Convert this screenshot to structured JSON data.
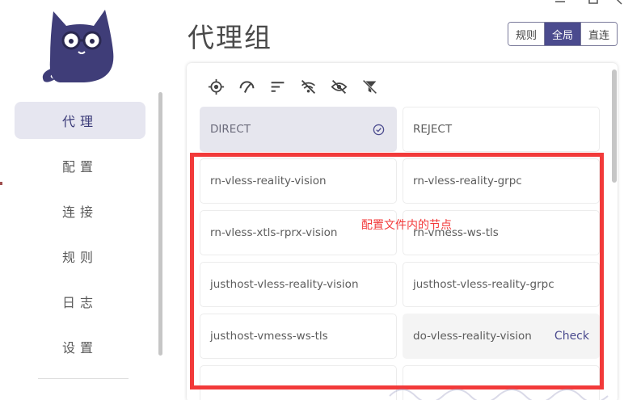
{
  "title": "代理组",
  "sidebar": {
    "items": [
      {
        "label": "代理",
        "active": true
      },
      {
        "label": "配置",
        "active": false
      },
      {
        "label": "连接",
        "active": false
      },
      {
        "label": "规则",
        "active": false
      },
      {
        "label": "日志",
        "active": false
      },
      {
        "label": "设置",
        "active": false
      }
    ]
  },
  "mode": {
    "options": [
      "规则",
      "全局",
      "直连"
    ],
    "selected": "全局"
  },
  "toolbar": {
    "icons": [
      "locate-icon",
      "speed-test-icon",
      "sort-icon",
      "wifi-off-icon",
      "eye-off-icon",
      "filter-off-icon"
    ]
  },
  "proxies": [
    {
      "name": "DIRECT",
      "selected": true
    },
    {
      "name": "REJECT",
      "selected": false
    },
    {
      "name": "rn-vless-reality-vision"
    },
    {
      "name": "rn-vless-reality-grpc"
    },
    {
      "name": "rn-vless-xtls-rprx-vision"
    },
    {
      "name": "rn-vmess-ws-tls"
    },
    {
      "name": "justhost-vless-reality-vision"
    },
    {
      "name": "justhost-vless-reality-grpc"
    },
    {
      "name": "justhost-vmess-ws-tls"
    },
    {
      "name": "do-vless-reality-vision",
      "check_label": "Check"
    }
  ],
  "annotation": {
    "text": "配置文件内的节点",
    "color": "#f23a3a"
  },
  "colors": {
    "accent": "#4b4b8e",
    "active_nav_bg": "#e6e6f0"
  }
}
